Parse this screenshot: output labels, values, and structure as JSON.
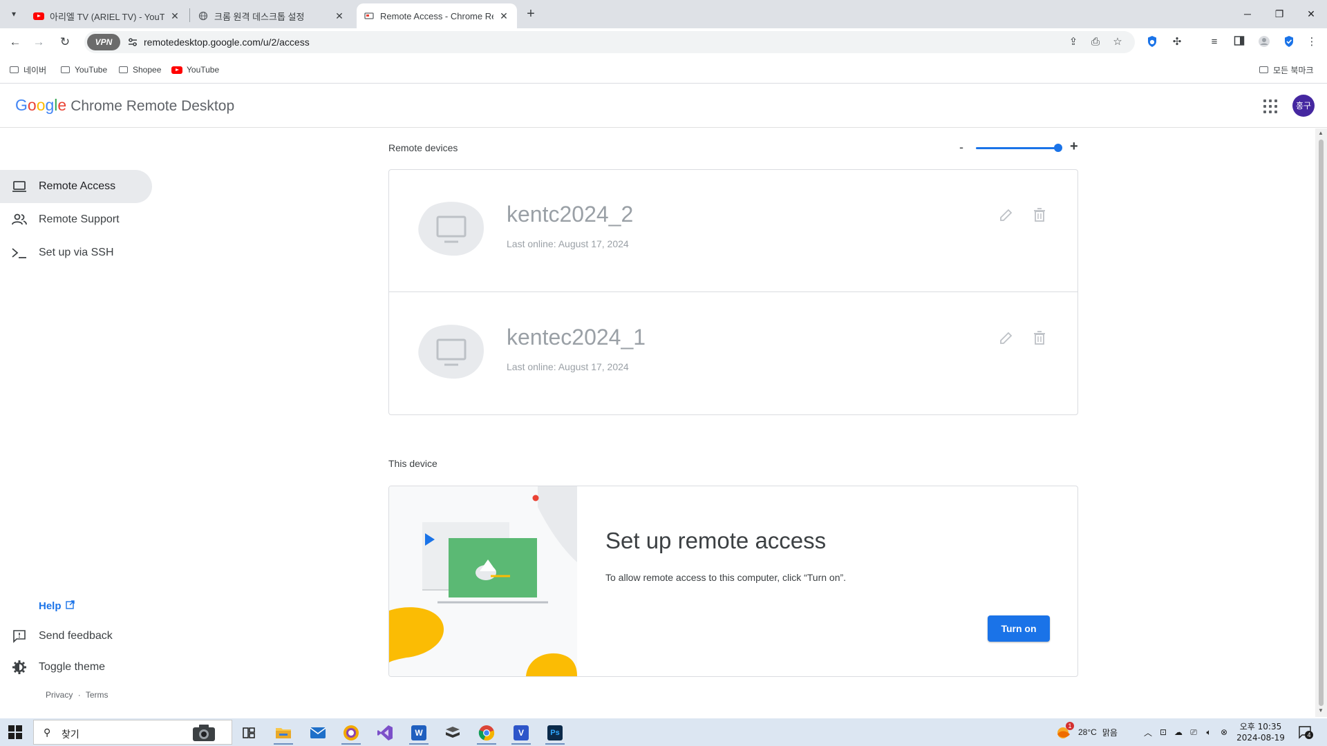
{
  "browser": {
    "tabs": [
      {
        "title": "아리엘 TV (ARIEL TV) - YouTube",
        "active": false
      },
      {
        "title": "크롬 원격 데스크톱 설정",
        "active": false
      },
      {
        "title": "Remote Access - Chrome Remote Desktop",
        "active": true
      }
    ],
    "url": "remotedesktop.google.com/u/2/access",
    "vpn_label": "VPN",
    "bookmarks": [
      {
        "label": "네이버",
        "icon": "folder-icon"
      },
      {
        "label": "YouTube",
        "icon": "folder-icon"
      },
      {
        "label": "Shopee",
        "icon": "folder-icon"
      },
      {
        "label": "YouTube",
        "icon": "youtube-icon"
      }
    ],
    "all_bookmarks_label": "모든 북마크"
  },
  "app": {
    "logo_letters": [
      "G",
      "o",
      "o",
      "g",
      "l",
      "e"
    ],
    "logo_colors": [
      "#4285F4",
      "#EA4335",
      "#FBBC05",
      "#4285F4",
      "#34A853",
      "#EA4335"
    ],
    "product_name": "Chrome Remote Desktop",
    "avatar_initials": "홍구"
  },
  "sidebar": {
    "items": [
      {
        "label": "Remote Access",
        "icon": "laptop-icon",
        "active": true
      },
      {
        "label": "Remote Support",
        "icon": "people-icon",
        "active": false
      },
      {
        "label": "Set up via SSH",
        "icon": "terminal-icon",
        "active": false
      }
    ],
    "help_label": "Help",
    "send_feedback_label": "Send feedback",
    "toggle_theme_label": "Toggle theme",
    "privacy_label": "Privacy",
    "terms_label": "Terms",
    "legal_separator": "·"
  },
  "main": {
    "remote_devices_title": "Remote devices",
    "zoom_minus": "-",
    "zoom_plus": "+",
    "zoom_level": 1.0,
    "devices": [
      {
        "name": "kentc2024_2",
        "status": "Last online: August 17, 2024"
      },
      {
        "name": "kentec2024_1",
        "status": "Last online: August 17, 2024"
      }
    ],
    "this_device_title": "This device",
    "setup_title": "Set up remote access",
    "setup_description": "To allow remote access to this computer, click “Turn on”.",
    "turn_on_label": "Turn on"
  },
  "taskbar": {
    "search_placeholder": "찾기",
    "weather_temp": "28°C",
    "weather_desc": "맑음",
    "weather_badge": "1",
    "time": "오후 10:35",
    "date": "2024-08-19",
    "notification_count": "4",
    "apps": [
      "task-view-icon",
      "file-explorer-icon",
      "mail-icon",
      "app-circle-icon",
      "visual-studio-icon",
      "word-icon",
      "book-app-icon",
      "chrome-icon",
      "v-app-icon",
      "photoshop-icon"
    ]
  },
  "colors": {
    "accent": "#1a73e8",
    "illustration_green": "#5bb974",
    "illustration_yellow": "#fbbc04",
    "illustration_red": "#ea4335"
  }
}
